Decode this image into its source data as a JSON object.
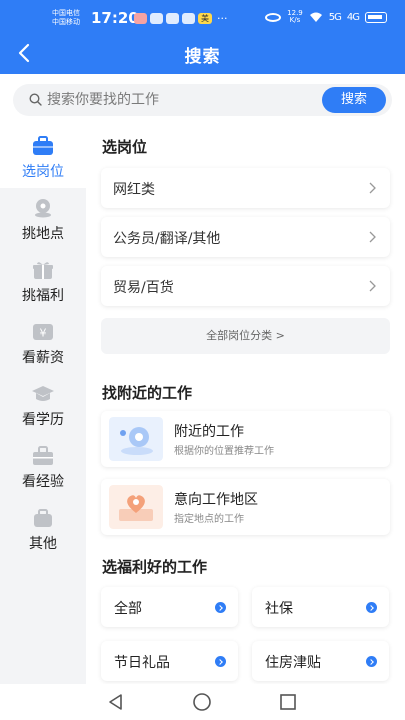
{
  "status_bar": {
    "carrier_1": "中国电信",
    "carrier_2": "中国移动",
    "time": "17:20",
    "notif_badge": "美",
    "notif_more": "···",
    "net_speed_value": "12.9",
    "net_speed_unit": "K/s",
    "signal_1": "5G",
    "signal_2": "4G"
  },
  "header": {
    "title": "搜索",
    "back_icon": "back-arrow-icon"
  },
  "search": {
    "placeholder": "搜索你要找的工作",
    "button_label": "搜索"
  },
  "sidebar": {
    "items": [
      {
        "label": "选岗位",
        "icon": "briefcase-icon",
        "active": true
      },
      {
        "label": "挑地点",
        "icon": "location-icon",
        "active": false
      },
      {
        "label": "挑福利",
        "icon": "gift-icon",
        "active": false
      },
      {
        "label": "看薪资",
        "icon": "yen-icon",
        "active": false
      },
      {
        "label": "看学历",
        "icon": "graduation-cap-icon",
        "active": false
      },
      {
        "label": "看经验",
        "icon": "toolbox-icon",
        "active": false
      },
      {
        "label": "其他",
        "icon": "bag-icon",
        "active": false
      }
    ]
  },
  "sections": {
    "positions": {
      "title": "选岗位",
      "items": [
        "网红类",
        "公务员/翻译/其他",
        "贸易/百货"
      ],
      "all_label": "全部岗位分类 >"
    },
    "nearby": {
      "title": "找附近的工作",
      "cards": [
        {
          "title": "附近的工作",
          "subtitle": "根据你的位置推荐工作"
        },
        {
          "title": "意向工作地区",
          "subtitle": "指定地点的工作"
        }
      ]
    },
    "benefits": {
      "title": "选福利好的工作",
      "items": [
        "全部",
        "社保",
        "节日礼品",
        "住房津贴"
      ]
    }
  },
  "colors": {
    "accent": "#2f7df6",
    "sidebar_bg": "#f3f4f6",
    "active_text": "#2f7df6"
  }
}
